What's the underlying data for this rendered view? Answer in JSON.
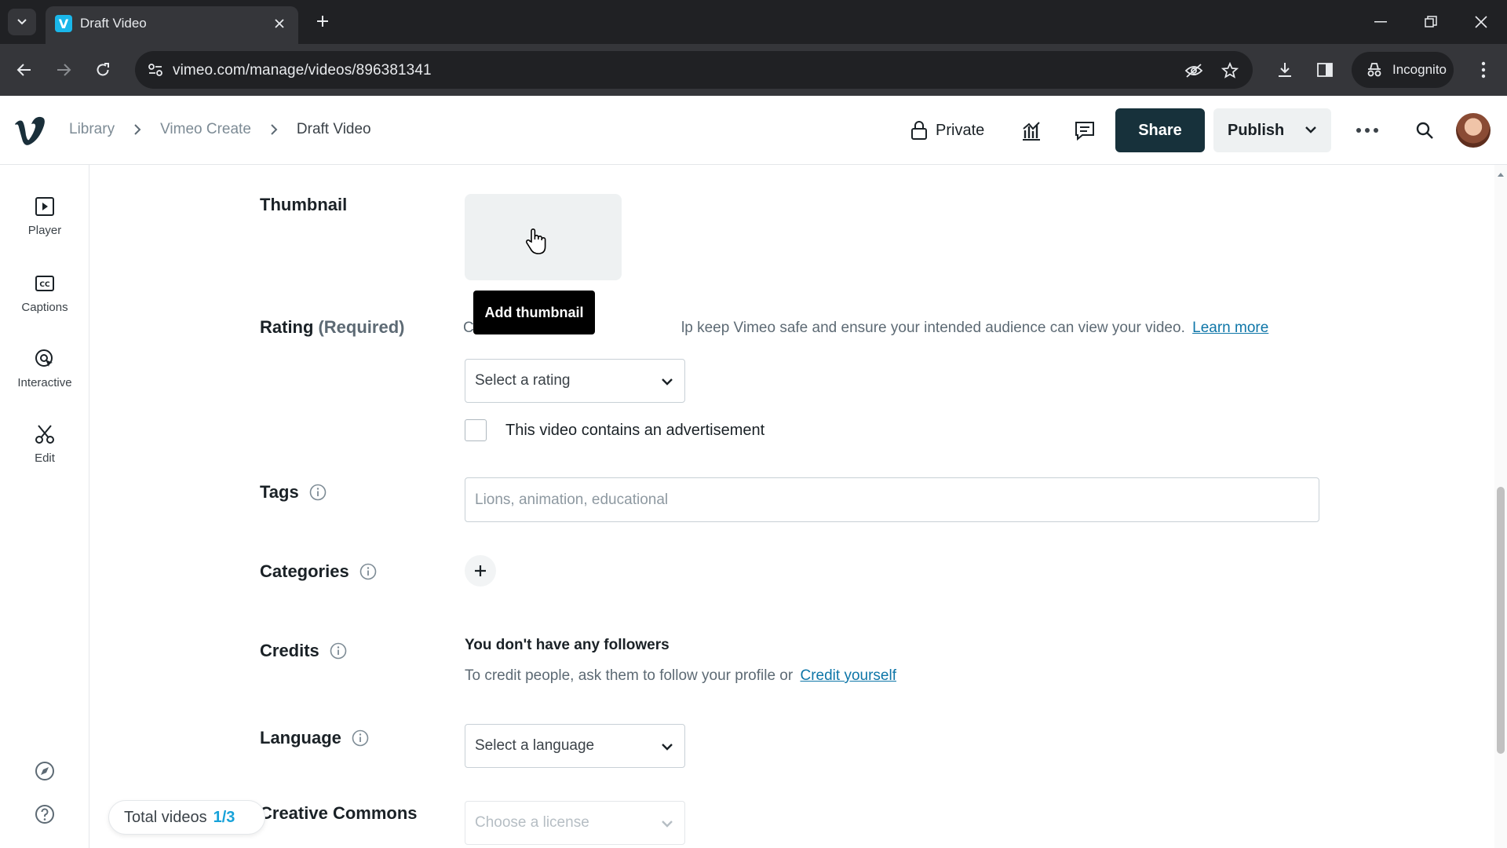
{
  "browser": {
    "tab_title": "Draft Video",
    "favicon_letter": "V",
    "url": "vimeo.com/manage/videos/896381341",
    "incognito_label": "Incognito"
  },
  "header": {
    "breadcrumb": [
      "Library",
      "Vimeo Create",
      "Draft Video"
    ],
    "privacy_label": "Private",
    "share_label": "Share",
    "publish_label": "Publish"
  },
  "rail": {
    "items": [
      {
        "label": "Player",
        "icon": "play-square-icon"
      },
      {
        "label": "Captions",
        "icon": "cc-icon"
      },
      {
        "label": "Interactive",
        "icon": "interactive-icon"
      },
      {
        "label": "Edit",
        "icon": "scissors-icon"
      }
    ]
  },
  "form": {
    "thumbnail": {
      "label": "Thumbnail",
      "tooltip": "Add thumbnail"
    },
    "rating": {
      "label": "Rating",
      "required": "(Required)",
      "help_left": "C",
      "help_right": "lp keep Vimeo safe and ensure your intended audience can view your video.",
      "learn_more": "Learn more",
      "select_placeholder": "Select a rating",
      "ad_checkbox_label": "This video contains an advertisement"
    },
    "tags": {
      "label": "Tags",
      "placeholder": "Lions, animation, educational"
    },
    "categories": {
      "label": "Categories"
    },
    "credits": {
      "label": "Credits",
      "title": "You don't have any followers",
      "help": "To credit people, ask them to follow your profile or",
      "link": "Credit yourself"
    },
    "language": {
      "label": "Language",
      "select_placeholder": "Select a language"
    },
    "creative_commons": {
      "label": "Creative Commons",
      "select_placeholder": "Choose a license"
    }
  },
  "footer": {
    "total_videos_label": "Total videos",
    "total_videos_count": "1/3"
  },
  "colors": {
    "accent": "#17a2d9",
    "share_bg": "#17313b",
    "link": "#0e76a8"
  }
}
